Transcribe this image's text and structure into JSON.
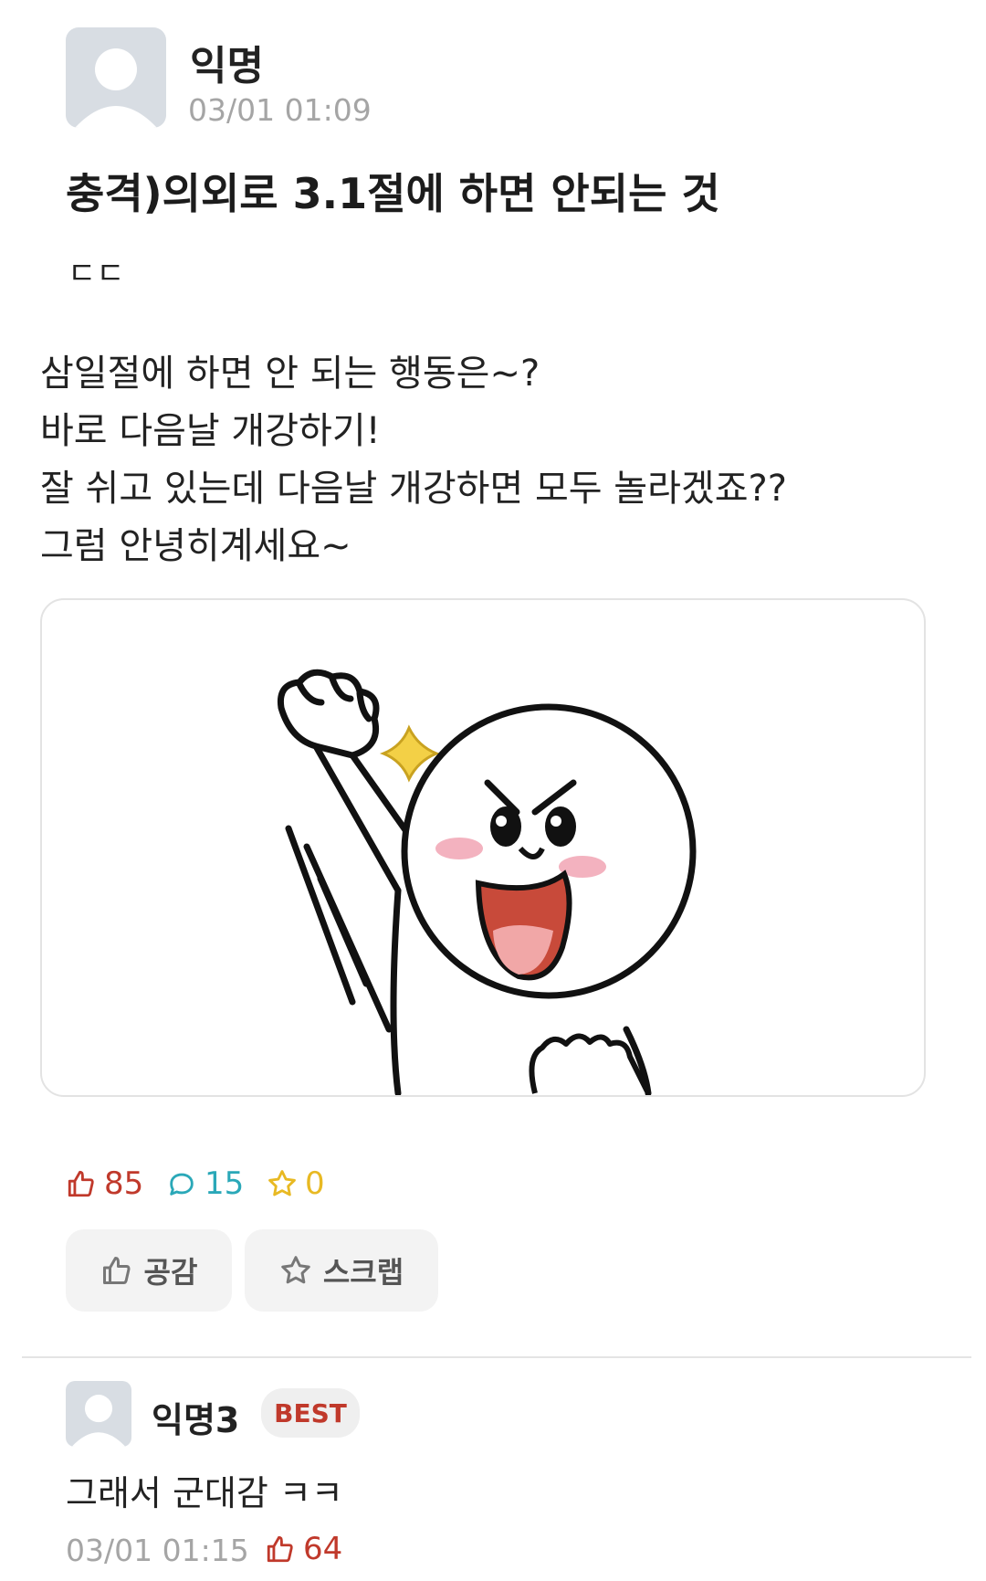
{
  "post": {
    "author": "익명",
    "time": "03/01 01:09",
    "title": "충격)의외로 3.1절에 하면 안되는 것",
    "subtitle": "ㄷㄷ",
    "body_lines": [
      "삼일절에 하면 안 되는 행동은~?",
      "바로 다음날 개강하기!",
      "잘 쉬고 있는데 다음날 개강하면 모두 놀라겠죠??",
      "그럼 안녕히계세요~"
    ],
    "stats": {
      "likes": "85",
      "comments": "15",
      "scraps": "0"
    },
    "buttons": {
      "like_label": "공감",
      "scrap_label": "스크랩"
    }
  },
  "comment": {
    "author": "익명3",
    "badge": "BEST",
    "text": "그래서 군대감 ㅋㅋ",
    "time": "03/01 01:15",
    "likes": "64"
  },
  "colors": {
    "like": "#c0392b",
    "comment": "#2aa8b8",
    "scrap": "#e8b923"
  }
}
